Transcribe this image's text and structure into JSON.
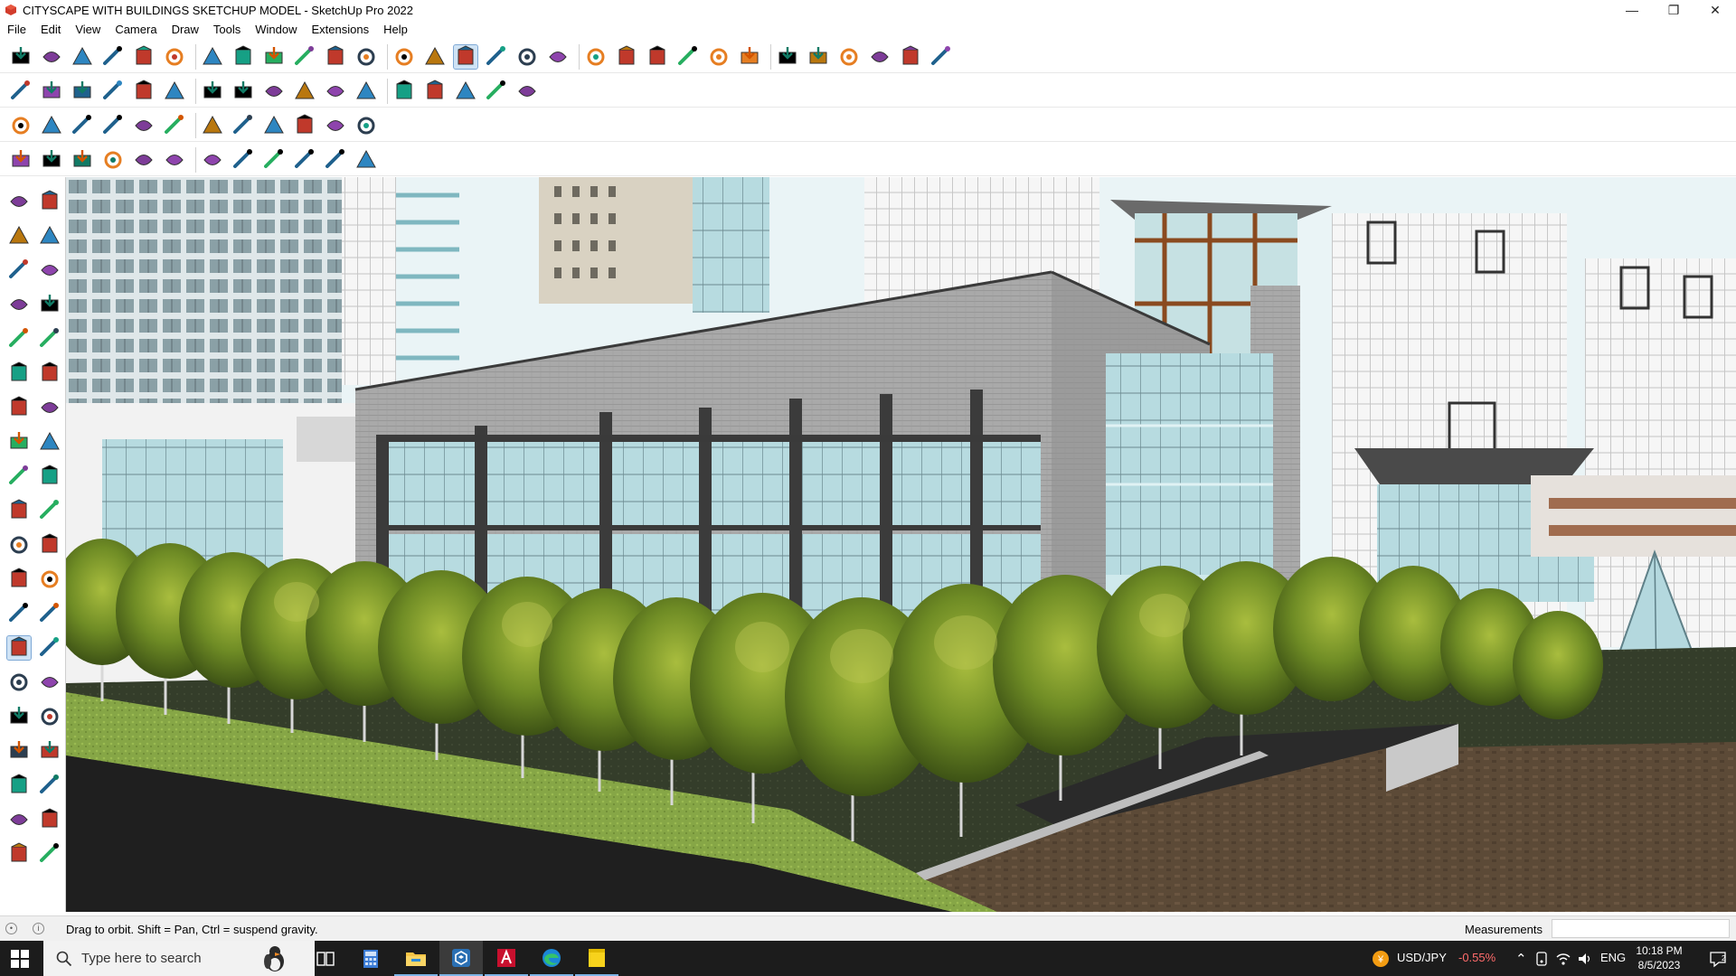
{
  "window": {
    "title": "CITYSCAPE WITH BUILDINGS SKETCHUP MODEL - SketchUp Pro 2022",
    "app_icon": "sketchup-icon",
    "controls": [
      "minimize-icon",
      "restore-icon",
      "close-icon"
    ]
  },
  "menubar": {
    "items": [
      "File",
      "Edit",
      "View",
      "Camera",
      "Draw",
      "Tools",
      "Window",
      "Extensions",
      "Help"
    ]
  },
  "toolbars": {
    "row1": [
      "zoom-extents-icon",
      "select-icon",
      "eraser-icon",
      "pencil-icon",
      "lasso-icon",
      "paint-bucket-icon",
      "push-pull-icon",
      "follow-me-icon",
      "move-icon",
      "rotate-icon",
      "scale-icon",
      "tape-measure-icon",
      "text-icon",
      "paint-icon",
      "orbit-icon",
      "pan-icon",
      "zoom-icon",
      "zoom-window-icon",
      "section-icon",
      "styles-icon",
      "layers-icon",
      "shadows-icon",
      "account-icon",
      "extension-warehouse-icon",
      "3d-warehouse-icon",
      "send-to-layout-icon",
      "flip-icon",
      "undo-icon",
      "redo-icon",
      "help-icon"
    ],
    "row2": [
      "component-icon",
      "group-icon",
      "solid-icon",
      "extrude-icon",
      "outline-icon",
      "shell-icon",
      "intersect-icon",
      "union-icon",
      "subtract-icon",
      "trim-icon",
      "split-icon",
      "house-icon",
      "roof-icon",
      "wall-icon",
      "building-icon",
      "curve-icon",
      "smoothing-icon"
    ],
    "row3": [
      "cube-icon",
      "plane-icon",
      "surface-icon",
      "mesh-icon",
      "loop-icon",
      "rectangle-icon",
      "grid-icon",
      "spline-icon",
      "polyline-icon",
      "arc-icon",
      "weld-icon",
      "bezier-icon"
    ],
    "row4": [
      "bend-icon",
      "twist-icon",
      "extrude-path-icon",
      "loft-icon",
      "sweep-icon",
      "fillet-icon",
      "chamfer-icon",
      "array-icon",
      "mirror-icon",
      "stair-icon",
      "fence-icon",
      "railing-icon"
    ],
    "active_tool": "orbit-icon"
  },
  "palette": {
    "tools": [
      "select-icon",
      "orbit-icon",
      "paint-icon",
      "eraser-icon",
      "component-icon",
      "tape-icon",
      "line-icon",
      "freehand-icon",
      "rectangle-icon",
      "rotated-rectangle-icon",
      "circle-icon",
      "polygon-icon",
      "arc-icon",
      "pie-icon",
      "move-icon",
      "push-pull-icon",
      "rotate-icon",
      "follow-me-icon",
      "scale-icon",
      "offset-icon",
      "tape-measure-icon",
      "dimension-icon",
      "protractor-icon",
      "text-icon",
      "axes-icon",
      "3d-text-icon",
      "orbit-icon",
      "pan-icon",
      "zoom-icon",
      "zoom-window-icon",
      "zoom-extents-icon",
      "previous-icon",
      "walk-icon",
      "look-around-icon",
      "footprints-icon",
      "position-camera-icon",
      "section-plane-icon",
      "layers-icon",
      "styles-icon",
      "shadows-icon"
    ],
    "active_tool": "orbit-icon"
  },
  "status": {
    "hint": "Drag to orbit. Shift = Pan, Ctrl = suspend gravity.",
    "measurements_label": "Measurements",
    "measurements_value": ""
  },
  "taskbar": {
    "search_placeholder": "Type here to search",
    "apps": [
      "task-view-icon",
      "calculator-icon",
      "file-explorer-icon",
      "sketchup-icon",
      "autocad-icon",
      "edge-icon",
      "sticky-notes-icon"
    ],
    "ticker": {
      "symbol": "USD/JPY",
      "change": "-0.55%",
      "change_color": "#ff6b6b"
    },
    "language": "ENG",
    "time": "10:18 PM",
    "date": "8/5/2023"
  },
  "colors": {
    "active_tool_bg": "#cfe3f5",
    "sky": "#eaf4f6",
    "facade_grey": "#a7a7a7",
    "glass": "#b8dde3",
    "tree_green": "#6f8c25",
    "grass": "#7d9f3a",
    "road": "#1f1f1f",
    "paving": "#5e4a35"
  }
}
